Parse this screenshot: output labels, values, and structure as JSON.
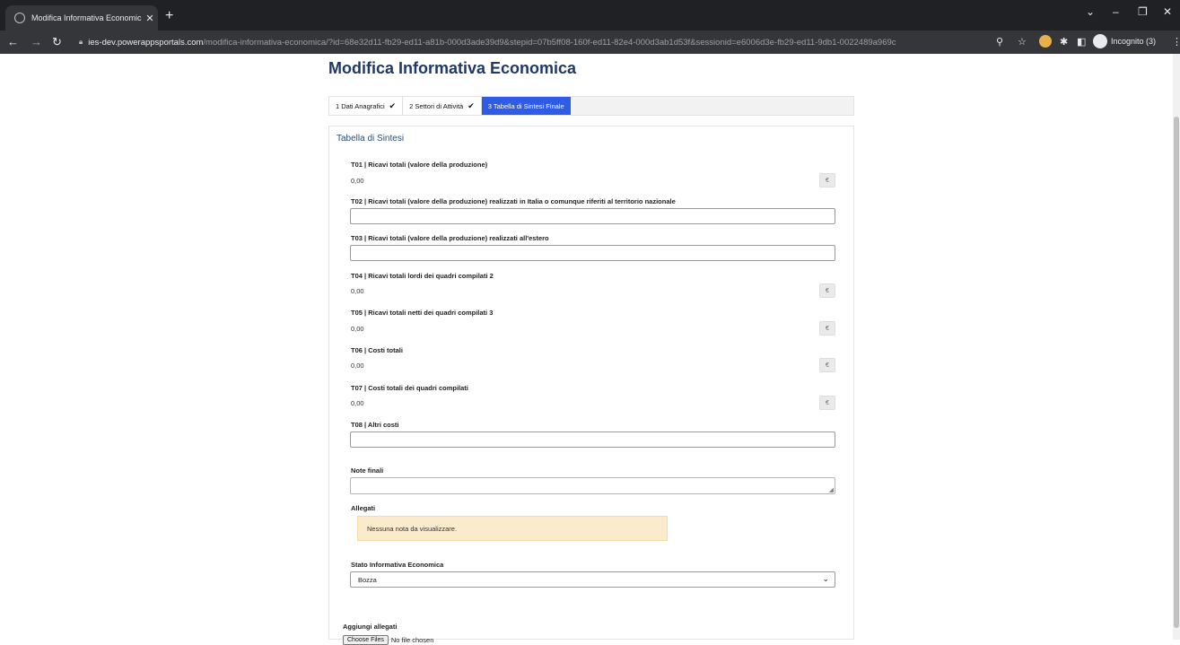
{
  "browser": {
    "tab_title": "Modifica Informativa Economica",
    "url_domain": "ies-dev.powerappsportals.com",
    "url_path": "/modifica-informativa-economica/?id=68e32d11-fb29-ed11-a81b-000d3ade39d9&stepid=07b5ff08-160f-ed11-82e4-000d3ab1d53f&sessionid=e6006d3e-fb29-ed11-9db1-0022489a969c",
    "incognito_label": "Incognito (3)"
  },
  "page": {
    "title": "Modifica Informativa Economica",
    "steps": [
      {
        "label": "1  Dati Anagrafici",
        "done": true
      },
      {
        "label": "2  Settori di Attività",
        "done": true
      },
      {
        "label": "3  Tabella di Sintesi Finale",
        "done": false
      }
    ],
    "panel_title": "Tabella di Sintesi",
    "fields": {
      "t01": {
        "label": "T01 | Ricavi totali (valore della produzione)",
        "value": "0,00"
      },
      "t02": {
        "label": "T02 | Ricavi totali (valore della produzione) realizzati in Italia o comunque riferiti al territorio nazionale",
        "value": ""
      },
      "t03": {
        "label": "T03 | Ricavi totali (valore della produzione) realizzati all'estero",
        "value": ""
      },
      "t04": {
        "label": "T04 | Ricavi totali lordi dei quadri compilati 2",
        "value": "0,00"
      },
      "t05": {
        "label": "T05 | Ricavi totali netti dei quadri compilati 3",
        "value": "0,00"
      },
      "t06": {
        "label": "T06 | Costi totali",
        "value": "0,00"
      },
      "t07": {
        "label": "T07 | Costi totali dei quadri compilati",
        "value": "0,00"
      },
      "t08": {
        "label": "T08 | Altri costi",
        "value": ""
      }
    },
    "currency_symbol": "€",
    "note_finali_label": "Note finali",
    "allegati_label": "Allegati",
    "allegati_empty": "Nessuna nota da visualizzare.",
    "stato_label": "Stato Informativa Economica",
    "stato_value": "Bozza",
    "aggiungi_label": "Aggiungi allegati",
    "file_button": "Choose Files",
    "file_status": "No file chosen"
  }
}
